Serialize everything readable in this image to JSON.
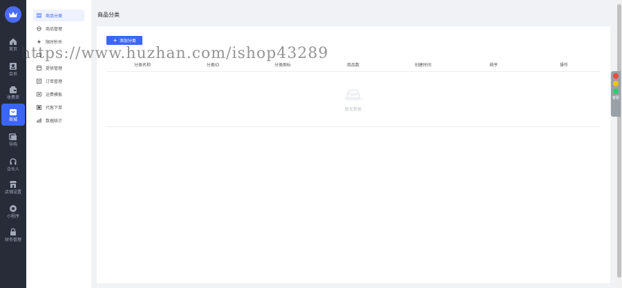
{
  "rail": {
    "items": [
      {
        "label": "首页",
        "icon": "home-icon"
      },
      {
        "label": "会员",
        "icon": "member-icon"
      },
      {
        "label": "收费单",
        "icon": "wallet-icon"
      },
      {
        "label": "商城",
        "icon": "shop-icon",
        "active": true
      },
      {
        "label": "导购",
        "icon": "guide-icon"
      },
      {
        "label": "合伙人",
        "icon": "headset-icon"
      },
      {
        "label": "店铺设置",
        "icon": "store-icon"
      },
      {
        "label": "小程序",
        "icon": "miniapp-icon"
      },
      {
        "label": "财务管理",
        "icon": "finance-icon"
      }
    ]
  },
  "submenu": {
    "items": [
      {
        "label": "商品分类",
        "icon": "grid-icon",
        "active": true
      },
      {
        "label": "商品管理",
        "icon": "goods-icon"
      },
      {
        "label": "限时秒杀",
        "icon": "flash-icon"
      },
      {
        "label": "",
        "icon": "coupon-icon"
      },
      {
        "label": "提供管理",
        "icon": "supply-icon"
      },
      {
        "label": "订单管理",
        "icon": "order-icon"
      },
      {
        "label": "运费模板",
        "icon": "freight-icon"
      },
      {
        "label": "代客下单",
        "icon": "proxy-order-icon"
      },
      {
        "label": "数据统计",
        "icon": "chart-icon"
      }
    ]
  },
  "page": {
    "title": "商品分类",
    "add_button": "添加分类",
    "columns": [
      "分类名称",
      "分类ID",
      "分类图标",
      "商品数",
      "创建时间",
      "排序",
      "操作"
    ],
    "empty_text": "暂无数据"
  },
  "watermark": "https://www.huzhan.com/ishop43289",
  "widget": {
    "text": "客服"
  },
  "colors": {
    "accent": "#3b66f5",
    "rail_bg": "#282c39"
  }
}
